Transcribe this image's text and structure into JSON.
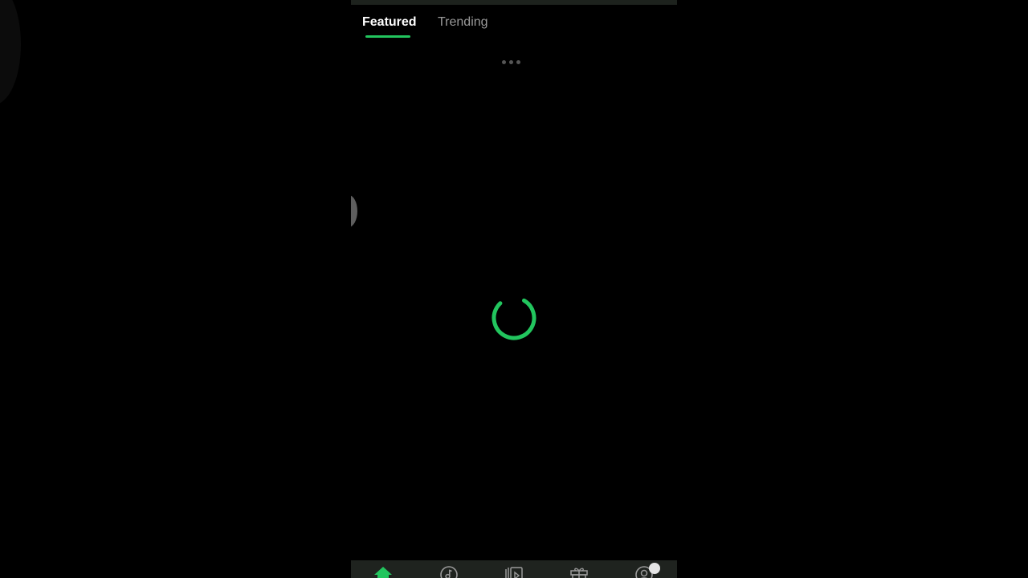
{
  "tabs": {
    "featured": "Featured",
    "trending": "Trending",
    "active": "featured"
  },
  "colors": {
    "accent": "#22c55e",
    "background": "#000000",
    "inactive_text": "#9a9a9a",
    "nav_bar": "#1f231f"
  },
  "loading": {
    "indicator": "spinner-icon",
    "more_indicator": "ellipsis-icon"
  },
  "bottom_nav": {
    "items": [
      {
        "icon": "home-icon",
        "active": true
      },
      {
        "icon": "music-disc-icon",
        "active": false
      },
      {
        "icon": "video-library-icon",
        "active": false
      },
      {
        "icon": "gift-icon",
        "active": false
      },
      {
        "icon": "profile-icon",
        "active": false,
        "badge": true
      }
    ]
  }
}
